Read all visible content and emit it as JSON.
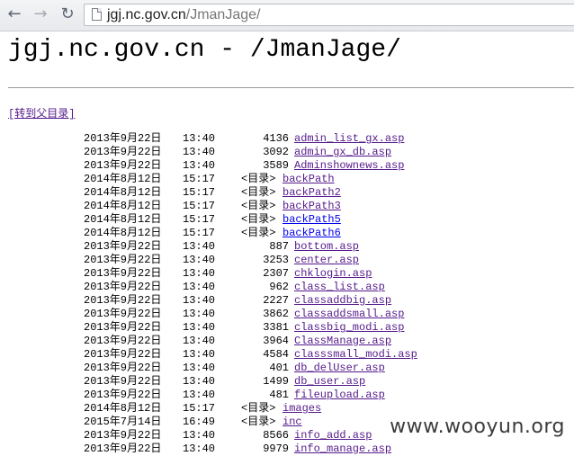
{
  "browser": {
    "url_domain": "jgj.nc.gov.cn",
    "url_path": "/JmanJage/"
  },
  "page": {
    "title": "jgj.nc.gov.cn - /JmanJage/",
    "parent_link": "[转到父目录]"
  },
  "files": [
    {
      "date": "2013年9月22日",
      "time": "13:40",
      "size": "4136",
      "name": "admin_list_gx.asp",
      "dir": false
    },
    {
      "date": "2013年9月22日",
      "time": "13:40",
      "size": "3092",
      "name": "admin_gx_db.asp",
      "dir": false
    },
    {
      "date": "2013年9月22日",
      "time": "13:40",
      "size": "3589",
      "name": "Adminshownews.asp",
      "dir": false
    },
    {
      "date": "2014年8月12日",
      "time": "15:17",
      "size": "<目录>",
      "name": "backPath",
      "dir": true
    },
    {
      "date": "2014年8月12日",
      "time": "15:17",
      "size": "<目录>",
      "name": "backPath2",
      "dir": true
    },
    {
      "date": "2014年8月12日",
      "time": "15:17",
      "size": "<目录>",
      "name": "backPath3",
      "dir": true
    },
    {
      "date": "2014年8月12日",
      "time": "15:17",
      "size": "<目录>",
      "name": "backPath5",
      "dir": true,
      "visited": false
    },
    {
      "date": "2014年8月12日",
      "time": "15:17",
      "size": "<目录>",
      "name": "backPath6",
      "dir": true,
      "visited": false
    },
    {
      "date": "2013年9月22日",
      "time": "13:40",
      "size": "887",
      "name": "bottom.asp",
      "dir": false
    },
    {
      "date": "2013年9月22日",
      "time": "13:40",
      "size": "3253",
      "name": "center.asp",
      "dir": false
    },
    {
      "date": "2013年9月22日",
      "time": "13:40",
      "size": "2307",
      "name": "chklogin.asp",
      "dir": false
    },
    {
      "date": "2013年9月22日",
      "time": "13:40",
      "size": "962",
      "name": "class_list.asp",
      "dir": false
    },
    {
      "date": "2013年9月22日",
      "time": "13:40",
      "size": "2227",
      "name": "classaddbig.asp",
      "dir": false
    },
    {
      "date": "2013年9月22日",
      "time": "13:40",
      "size": "3862",
      "name": "classaddsmall.asp",
      "dir": false
    },
    {
      "date": "2013年9月22日",
      "time": "13:40",
      "size": "3381",
      "name": "classbig_modi.asp",
      "dir": false
    },
    {
      "date": "2013年9月22日",
      "time": "13:40",
      "size": "3964",
      "name": "ClassManage.asp",
      "dir": false
    },
    {
      "date": "2013年9月22日",
      "time": "13:40",
      "size": "4584",
      "name": "classsmall_modi.asp",
      "dir": false
    },
    {
      "date": "2013年9月22日",
      "time": "13:40",
      "size": "401",
      "name": "db_delUser.asp",
      "dir": false
    },
    {
      "date": "2013年9月22日",
      "time": "13:40",
      "size": "1499",
      "name": "db_user.asp",
      "dir": false
    },
    {
      "date": "2013年9月22日",
      "time": "13:40",
      "size": "481",
      "name": "fileupload.asp",
      "dir": false
    },
    {
      "date": "2014年8月12日",
      "time": "15:17",
      "size": "<目录>",
      "name": "images",
      "dir": true
    },
    {
      "date": "2015年7月14日",
      "time": "16:49",
      "size": "<目录>",
      "name": "inc",
      "dir": true
    },
    {
      "date": "2013年9月22日",
      "time": "13:40",
      "size": "8566",
      "name": "info_add.asp",
      "dir": false
    },
    {
      "date": "2013年9月22日",
      "time": "13:40",
      "size": "9979",
      "name": "info_manage.asp",
      "dir": false
    }
  ],
  "watermark": "www.wooyun.org"
}
